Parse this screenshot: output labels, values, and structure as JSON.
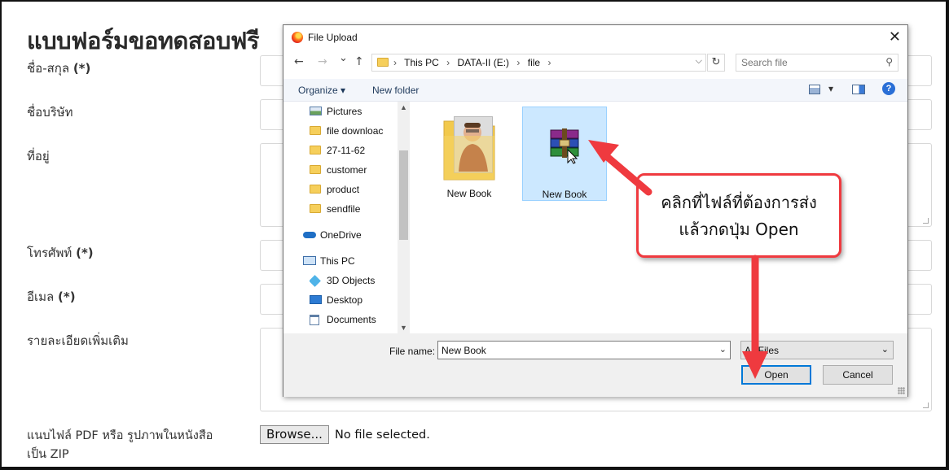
{
  "form": {
    "title": "แบบฟอร์มขอทดสอบฟรี",
    "fields": [
      {
        "label": "ชื่อ-สกุล",
        "required": "(*)"
      },
      {
        "label": "ชื่อบริษัท",
        "required": ""
      },
      {
        "label": "ที่อยู่",
        "required": ""
      },
      {
        "label": "โทรศัพท์",
        "required": "(*)"
      },
      {
        "label": "อีเมล",
        "required": "(*)"
      },
      {
        "label": "รายละเอียดเพิ่มเติม",
        "required": ""
      }
    ],
    "upload": {
      "label_line1": "แนบไฟล์ PDF หรือ รูปภาพในหนังสือ",
      "label_line2": "เป็น ZIP",
      "browse_label": "Browse...",
      "status": "No file selected."
    }
  },
  "dialog": {
    "title": "File Upload",
    "close": "✕",
    "nav": {
      "back": "←",
      "forward": "→",
      "recent": "⌄",
      "up": "↑"
    },
    "address": {
      "crumbs": [
        "This PC",
        "DATA-II (E:)",
        "file"
      ],
      "separator": "›"
    },
    "search_placeholder": "Search file",
    "toolbar": {
      "organize": "Organize ▾",
      "new_folder": "New folder"
    },
    "nav_pane": {
      "quick_access": [
        "Pictures",
        "file downloac",
        "27-11-62",
        "customer",
        "product",
        "sendfile"
      ],
      "onedrive": "OneDrive",
      "this_pc": "This PC",
      "pc_items": [
        "3D Objects",
        "Desktop",
        "Documents"
      ]
    },
    "files": [
      {
        "name": "New Book",
        "type": "folder",
        "selected": false
      },
      {
        "name": "New Book",
        "type": "winrar-archive",
        "selected": true
      }
    ],
    "file_name_label": "File name:",
    "file_name_value": "New Book",
    "file_type": "All Files",
    "open_label": "Open",
    "cancel_label": "Cancel"
  },
  "annotation": {
    "line1": "คลิกที่ไฟล์ที่ต้องการส่ง",
    "line2": "แล้วกดปุ่ม Open",
    "color": "#ef3a3f"
  }
}
